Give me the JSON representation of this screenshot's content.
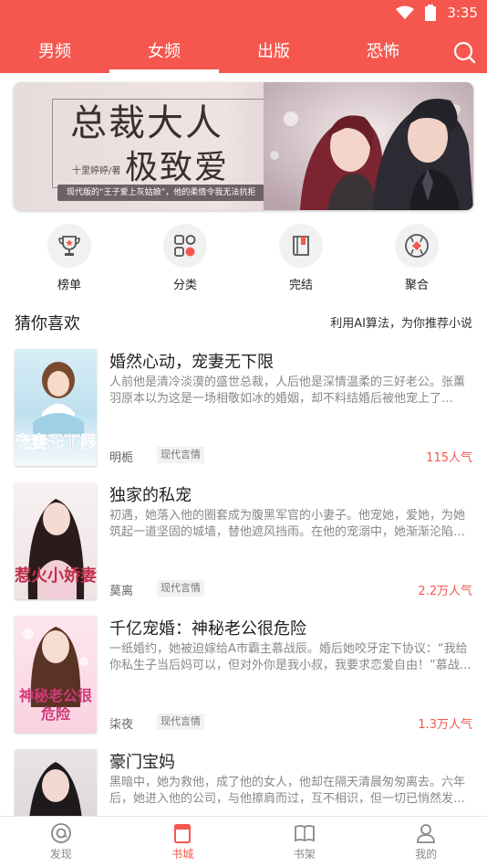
{
  "status_bar": {
    "time": "3:35"
  },
  "tabs": [
    {
      "label": "男频"
    },
    {
      "label": "女频"
    },
    {
      "label": "出版"
    },
    {
      "label": "恐怖"
    }
  ],
  "banner": {
    "title_line1": "总裁大人",
    "title_line2": "极致爱",
    "author": "十里婷婷/著",
    "tagline": "现代版的“王子爱上灰姑娘”，他的柔情令我无法抗拒"
  },
  "quick_links": [
    {
      "label": "榜单",
      "icon": "trophy-icon"
    },
    {
      "label": "分类",
      "icon": "category-icon"
    },
    {
      "label": "完结",
      "icon": "book-icon"
    },
    {
      "label": "聚合",
      "icon": "aggregate-icon"
    }
  ],
  "recommend": {
    "title": "猜你喜欢",
    "subtitle": "利用AI算法，为你推荐小说",
    "books": [
      {
        "title": "婚然心动，宠妻无下限",
        "desc": "人前他是清冷淡漠的盛世总裁，人后他是深情温柔的三好老公。张薰羽原本以为这是一场相敬如冰的婚姻，却不料结婚后被他宠上了…",
        "author": "明栀",
        "genre": "现代言情",
        "popularity": "115人气",
        "cover_text": "宠妻无下限"
      },
      {
        "title": "独家的私宠",
        "desc": "初遇，她落入他的圈套成为腹黑军官的小妻子。他宠她，爱她，为她筑起一道坚固的城墙，替他遮风挡雨。在他的宠溺中，她渐渐沦陷…",
        "author": "莫离",
        "genre": "现代言情",
        "popularity": "2.2万人气",
        "cover_text": "惹火小娇妻"
      },
      {
        "title": "千亿宠婚：神秘老公很危险",
        "desc": "一纸婚约，她被迫嫁给A市霸主慕战辰。婚后她咬牙定下协议：“我给你私生子当后妈可以，但对外你是我小叔，我要求恋爱自由！”慕战…",
        "author": "柒夜",
        "genre": "现代言情",
        "popularity": "1.3万人气",
        "cover_text": "神秘老公很危险"
      },
      {
        "title": "豪门宝妈",
        "desc": "黑暗中，她为救他，成了他的女人，他却在隔天清晨匆匆离去。六年后，她进入他的公司，与他擦肩而过，互不相识，但一切已悄然发…",
        "author": "",
        "genre": "",
        "popularity": "",
        "cover_text": ""
      }
    ]
  },
  "bottom_nav": [
    {
      "label": "发现"
    },
    {
      "label": "书城"
    },
    {
      "label": "书架"
    },
    {
      "label": "我的"
    }
  ],
  "colors": {
    "accent": "#f5574e"
  }
}
